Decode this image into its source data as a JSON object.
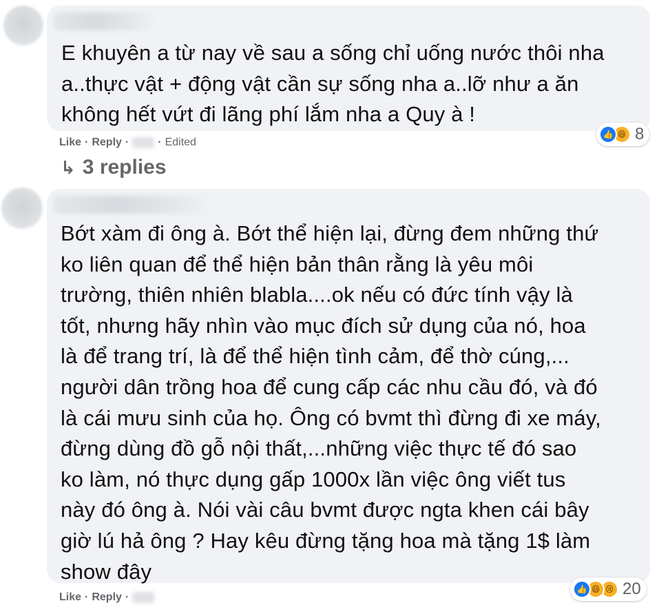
{
  "comments": [
    {
      "text": "E khuyên a từ nay về sau a sống chỉ uống nước thôi nha\na..thực vật + động vật cần sự sống nha a..lỡ như a ăn\nkhông hết vứt đi lãng phí lắm nha a Quy à !",
      "like_label": "Like",
      "reply_label": "Reply",
      "edited_label": "Edited",
      "reaction_count": "8",
      "reaction_icons": [
        "like-icon",
        "haha-icon"
      ]
    },
    {
      "text": "Bớt xàm đi ông à. Bớt thể hiện lại, đừng đem những thứ\nko liên quan để thể hiện bản thân rằng là yêu môi\ntrường, thiên nhiên blabla....ok nếu có đức tính vậy là\ntốt, nhưng hãy nhìn vào mục đích sử dụng của nó, hoa\nlà để trang trí, là để thể hiện tình cảm, để thờ cúng,...\nngười dân trồng hoa để cung cấp các nhu cầu đó, và đó\nlà cái mưu sinh của họ. Ông có bvmt thì đừng đi xe máy,\nđừng dùng đồ gỗ nội thất,...những việc thực tế đó sao\nko làm, nó thực dụng gấp 1000x lần việc ông viết tus\nnày đó ông à. Nói vài câu bvmt được ngta khen cái bây\ngiờ lú hả ông ? Hay kêu đừng tặng hoa mà tặng 1$ làm\nshow đây",
      "like_label": "Like",
      "reply_label": "Reply",
      "reaction_count": "20",
      "reaction_icons": [
        "like-icon",
        "haha-icon",
        "sad-icon"
      ]
    }
  ],
  "replies_link": {
    "arrow": "↳",
    "label": "3 replies"
  },
  "colors": {
    "bubble": "#f0f2f5",
    "secondary_text": "#65676b",
    "like_blue": "#1877f2",
    "haha_yellow": "#f7b125"
  }
}
